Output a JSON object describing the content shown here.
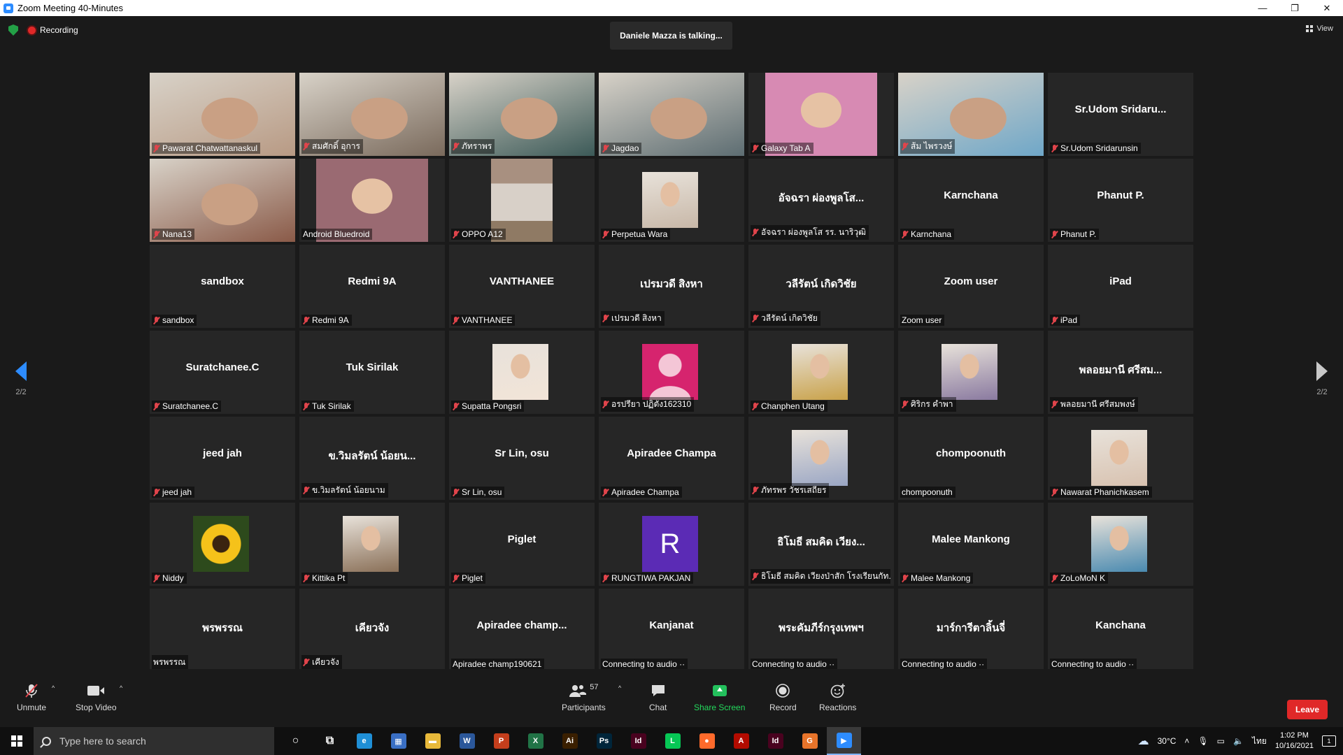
{
  "window": {
    "title": "Zoom Meeting 40-Minutes",
    "controls": [
      "—",
      "❐",
      "✕"
    ]
  },
  "status": {
    "recording_label": "Recording",
    "talking": "Daniele Mazza is talking...",
    "view_label": "View",
    "page_left": "2/2",
    "page_right": "2/2"
  },
  "tiles": [
    {
      "big": "",
      "label": "Pawarat Chatwattanaskul",
      "muted": true,
      "video": "photo",
      "bg": "#b89a84"
    },
    {
      "big": "",
      "label": "สมศักดิ์ อุการ",
      "muted": true,
      "video": "photo",
      "bg": "#7a6a5c"
    },
    {
      "big": "",
      "label": "ภัทราพร",
      "muted": true,
      "video": "photo",
      "bg": "#3c5a58"
    },
    {
      "big": "",
      "label": "Jagdao",
      "muted": true,
      "video": "photo",
      "bg": "#5d6d72"
    },
    {
      "big": "",
      "label": "Galaxy Tab A",
      "muted": true,
      "video": "photo-center",
      "bg": "#d78ab3"
    },
    {
      "big": "",
      "label": "ส้ม ไพรวงษ์",
      "muted": true,
      "video": "photo",
      "bg": "#6fa7c8"
    },
    {
      "big": "Sr.Udom  Sridaru...",
      "label": "Sr.Udom Sridarunsin",
      "muted": true,
      "video": "",
      "bg": ""
    },
    {
      "big": "",
      "label": "Nana13",
      "muted": true,
      "video": "photo",
      "bg": "#8a5a48"
    },
    {
      "big": "",
      "label": "Android Bluedroid",
      "muted": false,
      "video": "photo-center",
      "bg": "#9a6a72"
    },
    {
      "big": "",
      "label": "OPPO A12",
      "muted": true,
      "video": "photo-narrow",
      "bg": "#8f7a64"
    },
    {
      "big": "",
      "label": "Perpetua Wara",
      "muted": true,
      "video": "thumb",
      "bg": "#c8b8a8"
    },
    {
      "big": "อัจฉรา  ผ่องพูลโส...",
      "label": "อัจฉรา  ผ่องพูลโส  รร. นาริวุฒิ",
      "muted": true,
      "video": "",
      "bg": ""
    },
    {
      "big": "Karnchana",
      "label": "Karnchana",
      "muted": true,
      "video": "",
      "bg": ""
    },
    {
      "big": "Phanut P.",
      "label": "Phanut P.",
      "muted": true,
      "video": "",
      "bg": ""
    },
    {
      "big": "sandbox",
      "label": "sandbox",
      "muted": true,
      "video": "",
      "bg": ""
    },
    {
      "big": "Redmi 9A",
      "label": "Redmi 9A",
      "muted": true,
      "video": "",
      "bg": ""
    },
    {
      "big": "VANTHANEE",
      "label": "VANTHANEE",
      "muted": true,
      "video": "",
      "bg": ""
    },
    {
      "big": "เปรมวดี สิงหา",
      "label": "เปรมวดี สิงหา",
      "muted": true,
      "video": "",
      "bg": ""
    },
    {
      "big": "วลีรัตน์ เกิดวิชัย",
      "label": "วลีรัตน์ เกิดวิชัย",
      "muted": true,
      "video": "",
      "bg": ""
    },
    {
      "big": "Zoom user",
      "label": "Zoom user",
      "muted": false,
      "video": "",
      "bg": ""
    },
    {
      "big": "iPad",
      "label": "iPad",
      "muted": true,
      "video": "",
      "bg": ""
    },
    {
      "big": "Suratchanee.C",
      "label": "Suratchanee.C",
      "muted": true,
      "video": "",
      "bg": ""
    },
    {
      "big": "Tuk Sirilak",
      "label": "Tuk Sirilak",
      "muted": true,
      "video": "",
      "bg": ""
    },
    {
      "big": "",
      "label": "Supatta Pongsri",
      "muted": true,
      "video": "thumb",
      "bg": "#f2e4d8"
    },
    {
      "big": "",
      "label": "อรปรียา ปฏิตัง162310",
      "muted": true,
      "video": "thumb-avatar",
      "bg": "#d6246e"
    },
    {
      "big": "",
      "label": "Chanphen Utang",
      "muted": true,
      "video": "thumb",
      "bg": "#c9a24a"
    },
    {
      "big": "",
      "label": "ศิริกร คำพา",
      "muted": true,
      "video": "thumb",
      "bg": "#8a7aa0"
    },
    {
      "big": "พลอยมานี ศรีสม...",
      "label": "พลอยมานี ศรีสมพงษ์",
      "muted": true,
      "video": "",
      "bg": ""
    },
    {
      "big": "jeed jah",
      "label": "jeed jah",
      "muted": true,
      "video": "",
      "bg": ""
    },
    {
      "big": "ข.วิมลรัตน์ น้อยน...",
      "label": "ข.วิมลรัตน์ น้อยนาม",
      "muted": true,
      "video": "",
      "bg": ""
    },
    {
      "big": "Sr Lin, osu",
      "label": "Sr Lin, osu",
      "muted": true,
      "video": "",
      "bg": ""
    },
    {
      "big": "Apiradee Champa",
      "label": "Apiradee Champa",
      "muted": true,
      "video": "",
      "bg": ""
    },
    {
      "big": "",
      "label": "ภัทรพร วัชรเสถียร",
      "muted": true,
      "video": "thumb",
      "bg": "#9aa6c4"
    },
    {
      "big": "chompoonuth",
      "label": "chompoonuth",
      "muted": false,
      "video": "",
      "bg": ""
    },
    {
      "big": "",
      "label": "Nawarat Phanichkasem",
      "muted": true,
      "video": "thumb",
      "bg": "#d8c2b0"
    },
    {
      "big": "",
      "label": "Niddy",
      "muted": true,
      "video": "thumb-sun",
      "bg": "#2d4a1c"
    },
    {
      "big": "",
      "label": "Kittika Pt",
      "muted": true,
      "video": "thumb",
      "bg": "#8a7058"
    },
    {
      "big": "Piglet",
      "label": "Piglet",
      "muted": true,
      "video": "",
      "bg": ""
    },
    {
      "big": "",
      "label": "RUNGTIWA PAKJAN",
      "muted": true,
      "video": "thumb-letter",
      "bg": "#5b2bb5",
      "letter": "R"
    },
    {
      "big": "ธิโมธี สมคิด เวียง...",
      "label": "ธิโมธี สมคิด เวียงป่าสัก โรงเรียนกัท...",
      "muted": true,
      "video": "",
      "bg": ""
    },
    {
      "big": "Malee Mankong",
      "label": "Malee Mankong",
      "muted": true,
      "video": "",
      "bg": ""
    },
    {
      "big": "",
      "label": "ZoLoMoN K",
      "muted": true,
      "video": "thumb",
      "bg": "#4a8ab0"
    },
    {
      "big": "พรพรรณ",
      "label": "พรพรรณ",
      "muted": false,
      "video": "",
      "bg": ""
    },
    {
      "big": "เคียวจัง",
      "label": "เคียวจัง",
      "muted": true,
      "video": "",
      "bg": ""
    },
    {
      "big": "Apiradee  champ...",
      "label": "Apiradee champ190621",
      "muted": false,
      "video": "",
      "bg": ""
    },
    {
      "big": "Kanjanat",
      "label": "Connecting to audio ··",
      "muted": false,
      "video": "",
      "bg": ""
    },
    {
      "big": "พระคัมภีร์กรุงเทพฯ",
      "label": "Connecting to audio ··",
      "muted": false,
      "video": "",
      "bg": ""
    },
    {
      "big": "มาร์การีตาลิ้นจี่",
      "label": "Connecting to audio ··",
      "muted": false,
      "video": "",
      "bg": ""
    },
    {
      "big": "Kanchana",
      "label": "Connecting to audio ··",
      "muted": false,
      "video": "",
      "bg": ""
    }
  ],
  "toolbar": {
    "unmute": "Unmute",
    "stop_video": "Stop Video",
    "participants": "Participants",
    "participants_count": "57",
    "chat": "Chat",
    "share_screen": "Share Screen",
    "record": "Record",
    "reactions": "Reactions",
    "leave": "Leave"
  },
  "taskbar": {
    "search_placeholder": "Type here to search",
    "weather": "30°C",
    "lang": "ไทย",
    "time": "1:02 PM",
    "date": "10/16/2021",
    "notifications": "1",
    "apps": [
      {
        "name": "cortana-icon",
        "glyph": "○",
        "color": "transparent"
      },
      {
        "name": "task-view-icon",
        "glyph": "⧉",
        "color": "transparent"
      },
      {
        "name": "edge-icon",
        "glyph": "e",
        "color": "#1f8fd6"
      },
      {
        "name": "calculator-icon",
        "glyph": "▦",
        "color": "#3a6fc4"
      },
      {
        "name": "file-explorer-icon",
        "glyph": "▬",
        "color": "#e8b93a"
      },
      {
        "name": "word-icon",
        "glyph": "W",
        "color": "#2b579a"
      },
      {
        "name": "powerpoint-icon",
        "glyph": "P",
        "color": "#c43e1c"
      },
      {
        "name": "excel-icon",
        "glyph": "X",
        "color": "#217346"
      },
      {
        "name": "illustrator-icon",
        "glyph": "Ai",
        "color": "#3a1f00"
      },
      {
        "name": "photoshop-icon",
        "glyph": "Ps",
        "color": "#00253a"
      },
      {
        "name": "indesign-icon",
        "glyph": "Id",
        "color": "#49021f"
      },
      {
        "name": "line-icon",
        "glyph": "L",
        "color": "#06c755"
      },
      {
        "name": "firefox-icon",
        "glyph": "●",
        "color": "#ff6a2b"
      },
      {
        "name": "acrobat-icon",
        "glyph": "A",
        "color": "#b30b00"
      },
      {
        "name": "indesign-2-icon",
        "glyph": "Id",
        "color": "#49021f"
      },
      {
        "name": "grammarly-icon",
        "glyph": "G",
        "color": "#e8742a"
      },
      {
        "name": "zoom-icon",
        "glyph": "▶",
        "color": "#2d8cff"
      }
    ]
  }
}
